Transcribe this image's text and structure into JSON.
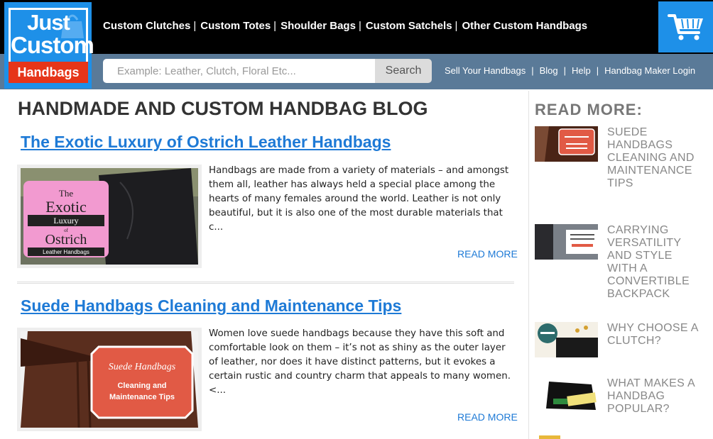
{
  "logo": {
    "line1": "Just",
    "line2": "Custom",
    "line3": "Handbags"
  },
  "nav": {
    "items": [
      "Custom Clutches",
      "Custom Totes",
      "Shoulder Bags",
      "Custom Satchels",
      "Other Custom Handbags"
    ],
    "separator": "|"
  },
  "search": {
    "placeholder": "Example: Leather, Clutch, Floral Etc...",
    "button": "Search"
  },
  "subnav": {
    "items": [
      "Sell Your Handbags",
      "Blog",
      "Help",
      "Handbag Maker Login"
    ],
    "separator": "|"
  },
  "main": {
    "title": "HANDMADE AND CUSTOM HANDBAG BLOG",
    "posts": [
      {
        "title": "The Exotic Luxury of Ostrich Leather Handbags",
        "excerpt": "Handbags are made from a variety of materials – and amongst them all, leather has always held a special place among the hearts of many females around the world. Leather is not only beautiful, but it is also one of the most durable materials that c...",
        "read_more": "READ MORE",
        "thumb_text": {
          "line1": "The",
          "line2": "Exotic",
          "line3": "Luxury",
          "line4": "of",
          "line5": "Ostrich",
          "line6": "Leather Handbags"
        }
      },
      {
        "title": "Suede Handbags Cleaning and Maintenance Tips",
        "excerpt": "Women love suede handbags because they have this soft and comfortable look on them – it’s not as shiny as the outer layer of leather, nor does it have distinct patterns, but it evokes a certain rustic and country charm that appeals to many women.<...",
        "read_more": "READ MORE",
        "thumb_text": {
          "line1": "Suede Handbags",
          "line2": "Cleaning and",
          "line3": "Maintenance Tips"
        }
      }
    ]
  },
  "sidebar": {
    "title": "READ MORE:",
    "items": [
      {
        "label": "SUEDE HANDBAGS CLEANING AND MAINTENANCE TIPS"
      },
      {
        "label": "CARRYING VERSATILITY AND STYLE WITH A CONVERTIBLE BACKPACK"
      },
      {
        "label": "WHY CHOOSE A CLUTCH?"
      },
      {
        "label": "WHAT MAKES A HANDBAG POPULAR?"
      }
    ]
  },
  "colors": {
    "brand_blue": "#1e90e8",
    "brand_red": "#e63519",
    "link_blue": "#1e7ad6",
    "subbar": "#5a7a98"
  }
}
